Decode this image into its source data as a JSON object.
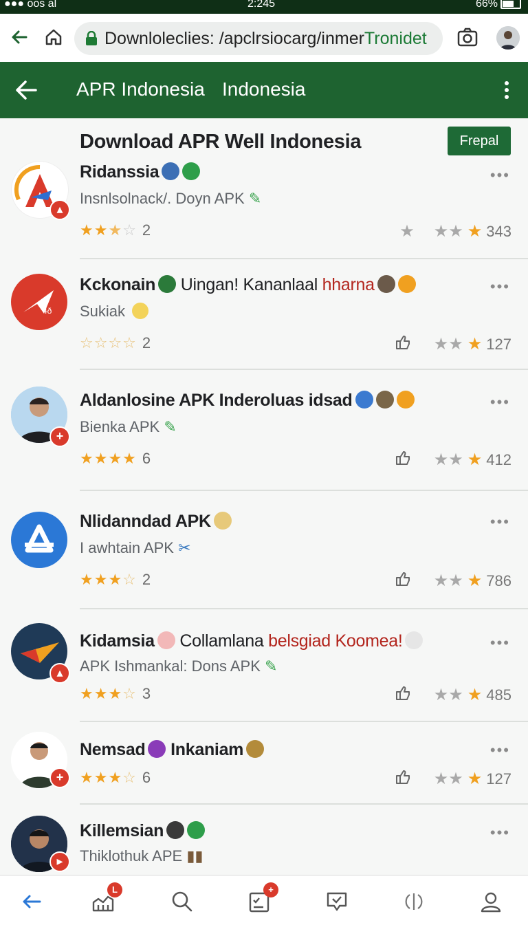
{
  "status": {
    "left": "oos al",
    "time": "2:245",
    "battery": "66%"
  },
  "browser": {
    "url_main": "Downloleclies: /apclrsiocarg/inmer ",
    "url_accent": "Tronidet"
  },
  "appbar": {
    "title1": "APR Indonesia",
    "title2": "Indonesia"
  },
  "page": {
    "title": "Download APR Well Indonesia",
    "action": "Frepal"
  },
  "apps": [
    {
      "name": "Ridanssia",
      "name_rest": "",
      "name_red": "",
      "sub": "Insnlsolnack/. Doyn APK",
      "rating": 2.5,
      "count": "2",
      "meta": "343"
    },
    {
      "name": "Kckonain",
      "name_rest": " Uingan! Kananlaal ",
      "name_red": "hharna",
      "sub": "Sukiak",
      "rating": 0,
      "count": "2",
      "meta": "127"
    },
    {
      "name": "Aldanlosine APK Inderoluas idsad",
      "name_rest": "",
      "name_red": "",
      "sub": "Bienka APK",
      "rating": 4,
      "count": "6",
      "meta": "412"
    },
    {
      "name": "Nlidanndad APK",
      "name_rest": "",
      "name_red": "",
      "sub": "I awhtain APK",
      "rating": 3.5,
      "count": "2",
      "meta": "786"
    },
    {
      "name": "Kidamsia",
      "name_rest": " Collamlana ",
      "name_red": "belsgiad Koomea!",
      "sub": "APK Ishmankal: Dons APK",
      "rating": 3.5,
      "count": "3",
      "meta": "485"
    },
    {
      "name": "Nemsad",
      "name_rest": "",
      "name_red": "",
      "name2": "Inkaniam",
      "sub": "",
      "rating": 3.5,
      "count": "6",
      "meta": "127"
    },
    {
      "name": "Killemsian",
      "name_rest": "",
      "name_red": "",
      "sub": "Thiklothuk APE",
      "rating": 0,
      "count": "",
      "meta": ""
    }
  ],
  "nav": {
    "badge_a": "L",
    "badge_b": "+"
  },
  "colors": {
    "primary": "#1e6330",
    "accent": "#f0a020",
    "badge": "#d93a2b"
  }
}
